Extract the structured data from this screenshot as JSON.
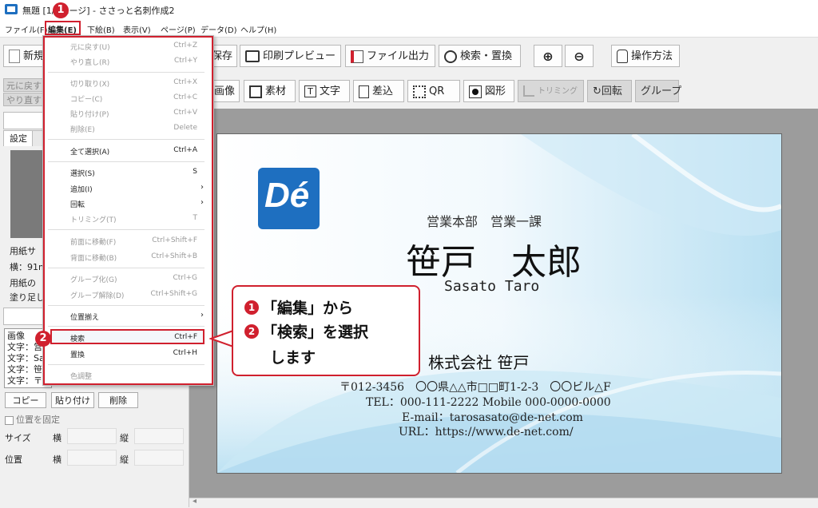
{
  "window": {
    "title": "無題 [1/1ページ] - ささっと名刺作成2"
  },
  "menubar": {
    "file": "ファイル(F)",
    "edit": "編集(E)",
    "drawing": "下絵(B)",
    "view": "表示(V)",
    "page": "ページ(P)",
    "data": "データ(D)",
    "help": "ヘルプ(H)"
  },
  "toolbar1": {
    "new": "新規",
    "save": "保存",
    "print_preview": "印刷プレビュー",
    "file_output": "ファイル出力",
    "search_replace": "検索・置換",
    "operation": "操作方法"
  },
  "toolbar2": {
    "undo": "元に戻す",
    "redo": "やり直す",
    "image": "画像",
    "material": "素材",
    "text": "文字",
    "insert": "差込",
    "qr": "QR",
    "shape": "図形",
    "trimming": "トリミング",
    "rotate": "回転",
    "group": "グループ"
  },
  "left_panel": {
    "tab_settings": "設定",
    "paper_size": "用紙サ",
    "width": "横：91m",
    "paper_label": "用紙の",
    "bleed": "塗り足し",
    "list_items": [
      "画像",
      "文字：営",
      "文字：Sa",
      "文字：笹",
      "文字：〒"
    ],
    "copy": "コピー",
    "paste": "貼り付け",
    "delete": "削除",
    "fix_position": "位置を固定",
    "size_label": "サイズ",
    "position_label": "位置",
    "horizontal": "横",
    "vertical": "縦"
  },
  "edit_menu": {
    "items": [
      {
        "label": "元に戻す(U)",
        "shortcut": "Ctrl+Z",
        "disabled": true
      },
      {
        "label": "やり直し(R)",
        "shortcut": "Ctrl+Y",
        "disabled": true
      },
      {
        "label": "切り取り(X)",
        "shortcut": "Ctrl+X",
        "disabled": true
      },
      {
        "label": "コピー(C)",
        "shortcut": "Ctrl+C",
        "disabled": true
      },
      {
        "label": "貼り付け(P)",
        "shortcut": "Ctrl+V",
        "disabled": true
      },
      {
        "label": "削除(E)",
        "shortcut": "Delete",
        "disabled": true
      },
      {
        "label": "全て選択(A)",
        "shortcut": "Ctrl+A",
        "disabled": false
      },
      {
        "label": "選択(S)",
        "shortcut": "S",
        "disabled": false
      },
      {
        "label": "追加(I)",
        "shortcut": "",
        "disabled": false
      },
      {
        "label": "回転",
        "shortcut": "",
        "disabled": false
      },
      {
        "label": "トリミング(T)",
        "shortcut": "T",
        "disabled": true
      },
      {
        "label": "前面に移動(F)",
        "shortcut": "Ctrl+Shift+F",
        "disabled": true
      },
      {
        "label": "背面に移動(B)",
        "shortcut": "Ctrl+Shift+B",
        "disabled": true
      },
      {
        "label": "グループ化(G)",
        "shortcut": "Ctrl+G",
        "disabled": true
      },
      {
        "label": "グループ解除(D)",
        "shortcut": "Ctrl+Shift+G",
        "disabled": true
      },
      {
        "label": "位置揃え",
        "shortcut": "",
        "disabled": false
      },
      {
        "label": "検索",
        "shortcut": "Ctrl+F",
        "disabled": false
      },
      {
        "label": "置換",
        "shortcut": "Ctrl+H",
        "disabled": false
      },
      {
        "label": "色調整",
        "shortcut": "",
        "disabled": true
      }
    ]
  },
  "markers": {
    "one": "1",
    "two": "2"
  },
  "callout": {
    "line1": "「編集」から",
    "line2": "「検索」を選択",
    "line3": "します"
  },
  "card": {
    "logo": "Dé",
    "department": "営業本部　営業一課",
    "name": "笹戸　太郎",
    "name_roman": "Sasato Taro",
    "company": "株式会社 笹戸",
    "address": "〒012-3456　〇〇県△△市□□町1-2-3　〇〇ビル△F",
    "tel": "TEL：000-111-2222 Mobile 000-0000-0000",
    "email": "E-mail：tarosasato@de-net.com",
    "url": "URL：https://www.de-net.com/"
  },
  "colors": {
    "accent": "#d0202e",
    "logo_blue": "#1e6fc0"
  }
}
